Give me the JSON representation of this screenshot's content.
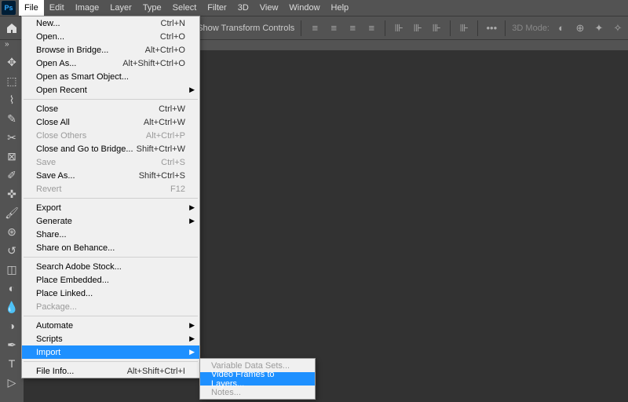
{
  "menubar": {
    "items": [
      "File",
      "Edit",
      "Image",
      "Layer",
      "Type",
      "Select",
      "Filter",
      "3D",
      "View",
      "Window",
      "Help"
    ],
    "logo": "Ps"
  },
  "optbar": {
    "transform": "Show Transform Controls",
    "mode3d": "3D Mode:"
  },
  "file_menu": {
    "g1": [
      {
        "l": "New...",
        "s": "Ctrl+N"
      },
      {
        "l": "Open...",
        "s": "Ctrl+O"
      },
      {
        "l": "Browse in Bridge...",
        "s": "Alt+Ctrl+O"
      },
      {
        "l": "Open As...",
        "s": "Alt+Shift+Ctrl+O"
      },
      {
        "l": "Open as Smart Object..."
      },
      {
        "l": "Open Recent",
        "sub": true
      }
    ],
    "g2": [
      {
        "l": "Close",
        "s": "Ctrl+W"
      },
      {
        "l": "Close All",
        "s": "Alt+Ctrl+W"
      },
      {
        "l": "Close Others",
        "s": "Alt+Ctrl+P",
        "dis": true
      },
      {
        "l": "Close and Go to Bridge...",
        "s": "Shift+Ctrl+W"
      },
      {
        "l": "Save",
        "s": "Ctrl+S",
        "dis": true
      },
      {
        "l": "Save As...",
        "s": "Shift+Ctrl+S"
      },
      {
        "l": "Revert",
        "s": "F12",
        "dis": true
      }
    ],
    "g3": [
      {
        "l": "Export",
        "sub": true
      },
      {
        "l": "Generate",
        "sub": true
      },
      {
        "l": "Share..."
      },
      {
        "l": "Share on Behance..."
      }
    ],
    "g4": [
      {
        "l": "Search Adobe Stock..."
      },
      {
        "l": "Place Embedded..."
      },
      {
        "l": "Place Linked..."
      },
      {
        "l": "Package...",
        "dis": true
      }
    ],
    "g5": [
      {
        "l": "Automate",
        "sub": true
      },
      {
        "l": "Scripts",
        "sub": true
      },
      {
        "l": "Import",
        "sub": true,
        "hl": true
      }
    ],
    "g6": [
      {
        "l": "File Info...",
        "s": "Alt+Shift+Ctrl+I"
      }
    ]
  },
  "import_submenu": [
    {
      "l": "Variable Data Sets...",
      "dis": true
    },
    {
      "l": "Video Frames to Layers...",
      "hl": true
    },
    {
      "l": "Notes...",
      "dis": true
    }
  ]
}
